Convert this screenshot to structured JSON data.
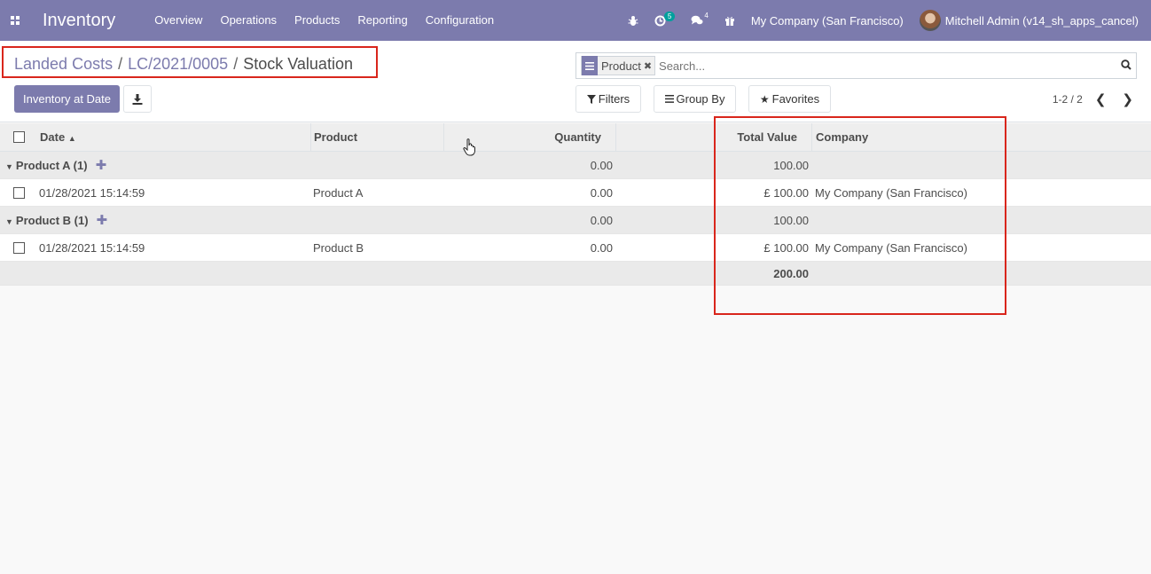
{
  "navbar": {
    "app_title": "Inventory",
    "menu": [
      "Overview",
      "Operations",
      "Products",
      "Reporting",
      "Configuration"
    ],
    "activity_count": "5",
    "message_count": "4",
    "company": "My Company (San Francisco)",
    "user": "Mitchell Admin (v14_sh_apps_cancel)"
  },
  "breadcrumb": {
    "items": [
      "Landed Costs",
      "LC/2021/0005"
    ],
    "current": "Stock Valuation",
    "separator": "/"
  },
  "buttons": {
    "inventory_at_date": "Inventory at Date",
    "filters": "Filters",
    "group_by": "Group By",
    "favorites": "Favorites"
  },
  "search": {
    "facet_value": "Product",
    "placeholder": "Search..."
  },
  "pager": {
    "value": "1-2 / 2"
  },
  "table": {
    "columns": {
      "date": "Date",
      "product": "Product",
      "quantity": "Quantity",
      "total_value": "Total Value",
      "company": "Company"
    },
    "groups": [
      {
        "label": "Product A (1)",
        "quantity": "0.00",
        "total_value": "100.00",
        "rows": [
          {
            "date": "01/28/2021 15:14:59",
            "product": "Product A",
            "quantity": "0.00",
            "total_value": "£ 100.00",
            "company": "My Company (San Francisco)"
          }
        ]
      },
      {
        "label": "Product B (1)",
        "quantity": "0.00",
        "total_value": "100.00",
        "rows": [
          {
            "date": "01/28/2021 15:14:59",
            "product": "Product B",
            "quantity": "0.00",
            "total_value": "£ 100.00",
            "company": "My Company (San Francisco)"
          }
        ]
      }
    ],
    "grand_total": "200.00"
  },
  "colors": {
    "brand": "#7c7bad",
    "highlight": "#d9261c",
    "badge": "#00a09d"
  },
  "icons": [
    "apps-grid-icon",
    "bug-icon",
    "clock-icon",
    "chat-icon",
    "gift-icon",
    "download-icon",
    "search-icon",
    "filter-icon",
    "group-by-icon",
    "star-icon",
    "chevron-left-icon",
    "chevron-right-icon",
    "hand-pointer-icon"
  ]
}
